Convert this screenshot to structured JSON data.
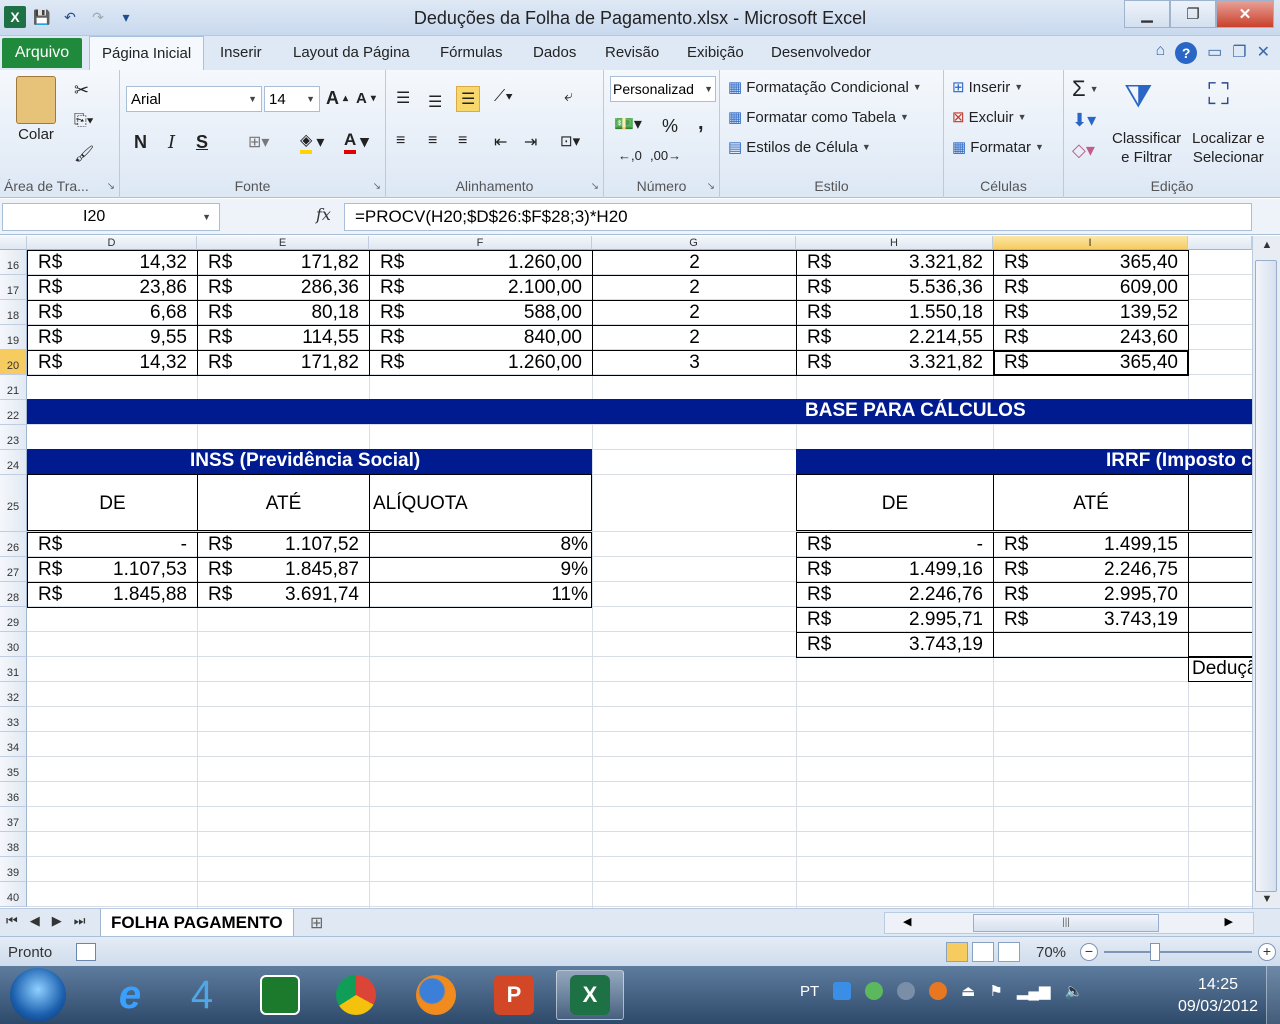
{
  "window": {
    "title": "Deduções da Folha de Pagamento.xlsx - Microsoft Excel",
    "minimize": "▁",
    "maximize": "❐",
    "close": "✕"
  },
  "tabs": {
    "file": "Arquivo",
    "items": [
      "Página Inicial",
      "Inserir",
      "Layout da Página",
      "Fórmulas",
      "Dados",
      "Revisão",
      "Exibição",
      "Desenvolvedor"
    ],
    "help": "?"
  },
  "ribbon": {
    "clipboard": {
      "label": "Área de Tra...",
      "paste": "Colar"
    },
    "font": {
      "label": "Fonte",
      "name": "Arial",
      "size": "14",
      "bold": "N",
      "italic": "I",
      "underline": "S"
    },
    "alignment": {
      "label": "Alinhamento"
    },
    "number": {
      "label": "Número",
      "format": "Personalizad",
      "percent": "%",
      "comma": ","
    },
    "styles": {
      "label": "Estilo",
      "conditional": "Formatação Condicional",
      "table": "Formatar como Tabela",
      "cell": "Estilos de Célula"
    },
    "cells": {
      "label": "Células",
      "insert": "Inserir",
      "delete": "Excluir",
      "format": "Formatar"
    },
    "editing": {
      "label": "Edição",
      "sum": "Σ",
      "sort1": "Classificar",
      "sort2": "e Filtrar",
      "find1": "Localizar e",
      "find2": "Selecionar"
    }
  },
  "formula_bar": {
    "name_box": "I20",
    "fx": "fx",
    "formula": "=PROCV(H20;$D$26:$F$28;3)*H20"
  },
  "columns": [
    "D",
    "E",
    "F",
    "G",
    "H",
    "I"
  ],
  "rows": [
    "16",
    "17",
    "18",
    "19",
    "20",
    "21",
    "22",
    "23",
    "24",
    "25",
    "26",
    "27",
    "28",
    "29",
    "30",
    "31",
    "32",
    "33",
    "34",
    "35",
    "36",
    "37",
    "38",
    "39",
    "40"
  ],
  "top_table": [
    {
      "d": "14,32",
      "e": "171,82",
      "f": "1.260,00",
      "g": "2",
      "h": "3.321,82",
      "i": "365,40"
    },
    {
      "d": "23,86",
      "e": "286,36",
      "f": "2.100,00",
      "g": "2",
      "h": "5.536,36",
      "i": "609,00"
    },
    {
      "d": "6,68",
      "e": "80,18",
      "f": "588,00",
      "g": "2",
      "h": "1.550,18",
      "i": "139,52"
    },
    {
      "d": "9,55",
      "e": "114,55",
      "f": "840,00",
      "g": "2",
      "h": "2.214,55",
      "i": "243,60"
    },
    {
      "d": "14,32",
      "e": "171,82",
      "f": "1.260,00",
      "g": "3",
      "h": "3.321,82",
      "i": "365,40"
    }
  ],
  "currency": "R$",
  "base_banner": "BASE PARA CÁLCULOS",
  "inss": {
    "title": "INSS (Previdência Social)",
    "headers": [
      "DE",
      "ATÉ",
      "ALÍQUOTA"
    ],
    "rows": [
      {
        "de": "-",
        "ate": "1.107,52",
        "aliq": "8%"
      },
      {
        "de": "1.107,53",
        "ate": "1.845,87",
        "aliq": "9%"
      },
      {
        "de": "1.845,88",
        "ate": "3.691,74",
        "aliq": "11%"
      }
    ]
  },
  "irrf": {
    "title": "IRRF (Imposto c",
    "headers": [
      "DE",
      "ATÉ"
    ],
    "rows": [
      {
        "de": "-",
        "ate": "1.499,15"
      },
      {
        "de": "1.499,16",
        "ate": "2.246,75"
      },
      {
        "de": "2.246,76",
        "ate": "2.995,70"
      },
      {
        "de": "2.995,71",
        "ate": "3.743,19"
      },
      {
        "de": "3.743,19",
        "ate": ""
      }
    ],
    "deduction_label": "Deduçã"
  },
  "sheet": {
    "tab": "FOLHA PAGAMENTO",
    "nav": [
      "⏮",
      "◀",
      "▶",
      "⏭"
    ],
    "hscroll_mark": "|||"
  },
  "status": {
    "ready": "Pronto",
    "zoom": "70%",
    "zoom_minus": "−",
    "zoom_plus": "+"
  },
  "taskbar": {
    "lang": "PT",
    "time": "14:25",
    "date": "09/03/2012",
    "app4": "4"
  }
}
